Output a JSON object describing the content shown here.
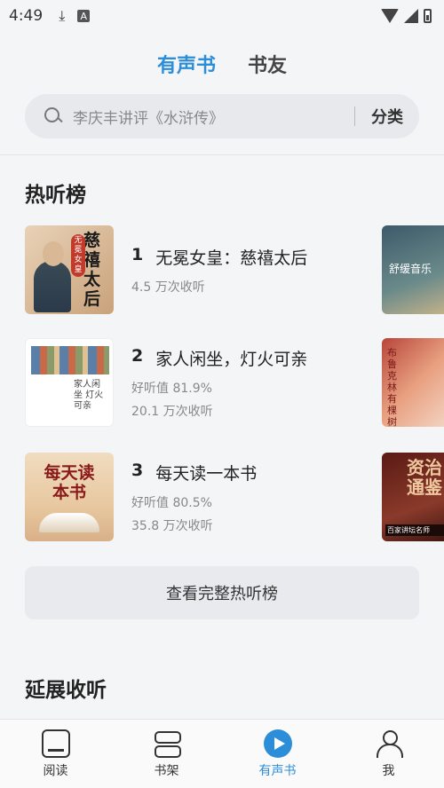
{
  "status_bar": {
    "time": "4:49",
    "download_icon": "download-icon",
    "a_icon": "A"
  },
  "top_tabs": [
    {
      "label": "有声书",
      "active": true
    },
    {
      "label": "书友",
      "active": false
    }
  ],
  "search": {
    "placeholder": "李庆丰讲评《水浒传》",
    "category_label": "分类"
  },
  "hot_section": {
    "title": "热听榜",
    "items": [
      {
        "rank": "1",
        "title": "无冕女皇：慈禧太后",
        "rating": "",
        "plays": "4.5 万次收听",
        "cover_text": "慈禧太后",
        "cover_badge": "无冕女皇"
      },
      {
        "rank": "2",
        "title": "家人闲坐，灯火可亲",
        "rating": "好听值 81.9%",
        "plays": "20.1 万次收听",
        "cover_text": "家人闲坐 灯火可亲"
      },
      {
        "rank": "3",
        "title": "每天读一本书",
        "rating": "好听值 80.5%",
        "plays": "35.8 万次收听",
        "cover_text": "每天读本书"
      }
    ],
    "side_covers": [
      {
        "text": "舒缓音乐"
      },
      {
        "text": "布鲁克林有棵树"
      },
      {
        "text": "资治通鉴",
        "subtext": "百家讲坛名师"
      }
    ],
    "view_all_label": "查看完整热听榜"
  },
  "extend_section": {
    "title": "延展收听"
  },
  "bottom_nav": [
    {
      "label": "阅读",
      "icon": "read-icon",
      "active": false
    },
    {
      "label": "书架",
      "icon": "bookshelf-icon",
      "active": false
    },
    {
      "label": "有声书",
      "icon": "audiobook-play-icon",
      "active": true
    },
    {
      "label": "我",
      "icon": "profile-icon",
      "active": false
    }
  ],
  "colors": {
    "accent": "#2c8ed8",
    "background": "#f4f5f7"
  }
}
